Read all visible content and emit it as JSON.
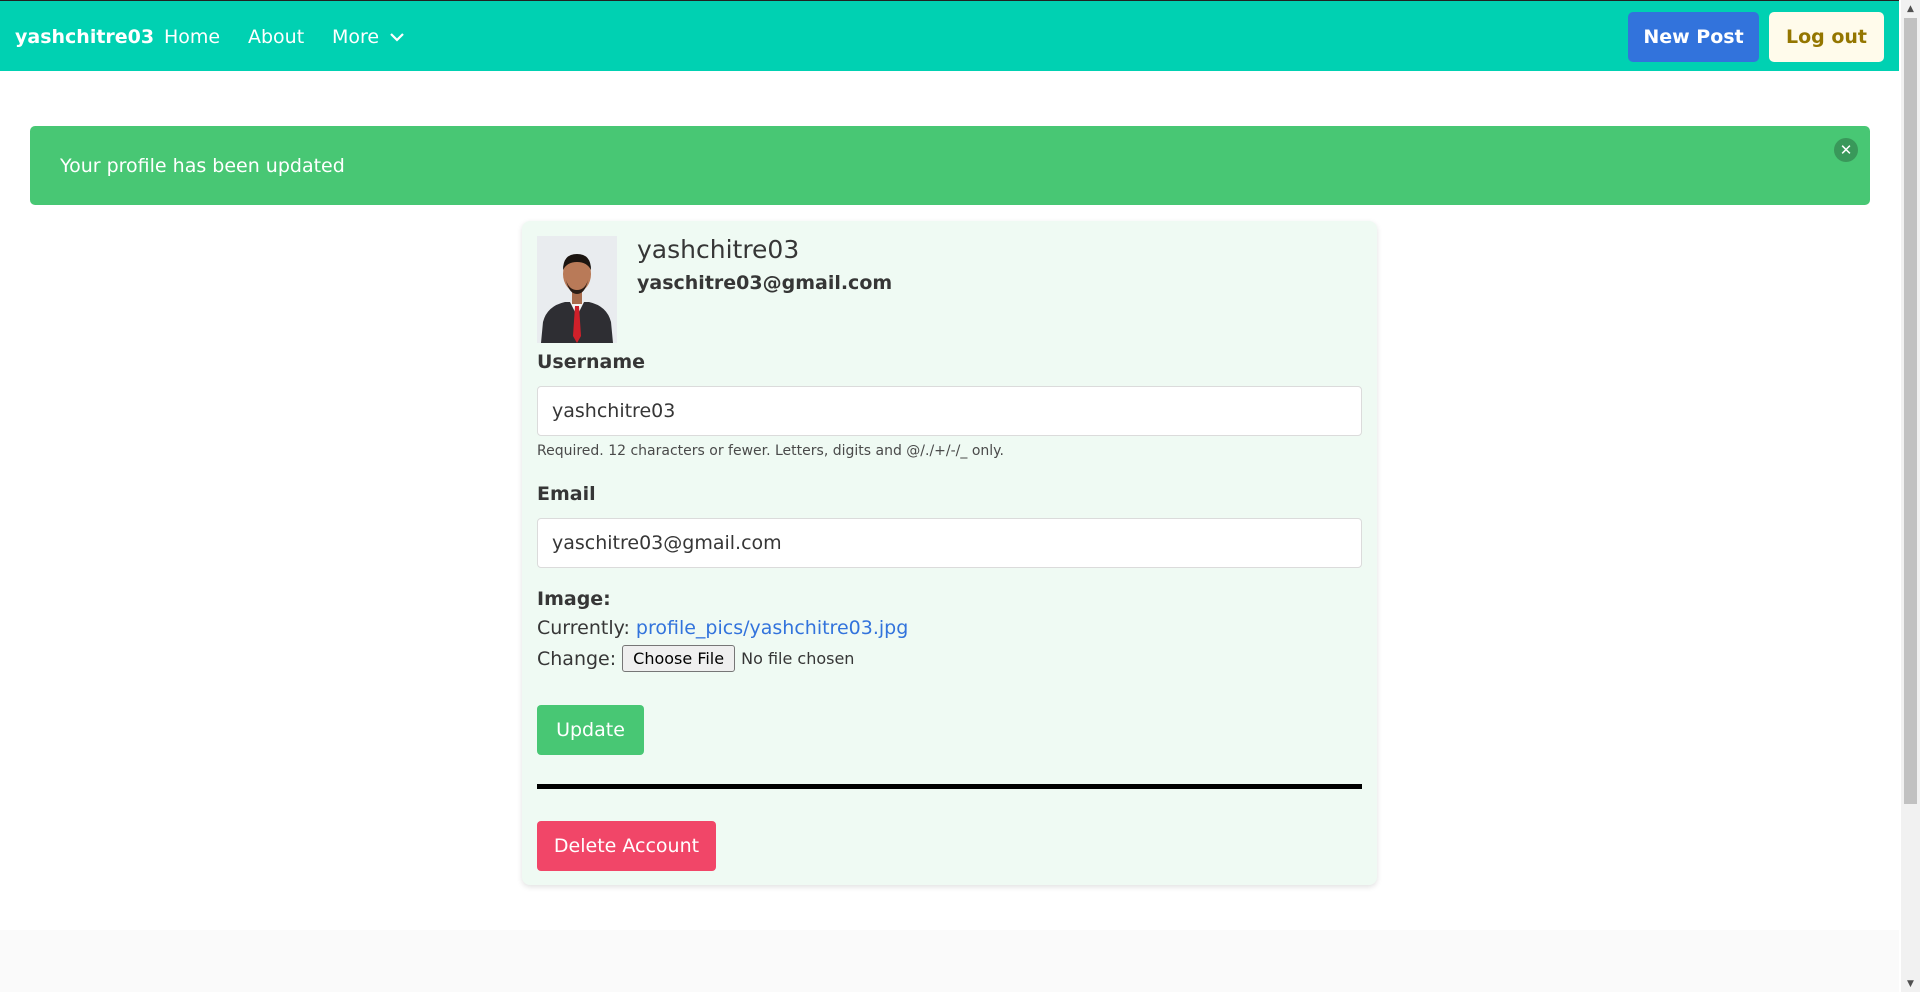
{
  "navbar": {
    "brand": "yashchitre03",
    "home": "Home",
    "about": "About",
    "more": "More",
    "new_post": "New Post",
    "logout": "Log out"
  },
  "notification": {
    "message": "Your profile has been updated",
    "close_icon": "close-icon"
  },
  "profile": {
    "username": "yashchitre03",
    "email": "yaschitre03@gmail.com"
  },
  "form": {
    "username_label": "Username",
    "username_value": "yashchitre03",
    "username_help": "Required. 12 characters or fewer. Letters, digits and @/./+/-/_ only.",
    "email_label": "Email",
    "email_value": "yaschitre03@gmail.com",
    "image_label": "Image:",
    "currently_label": "Currently:",
    "current_image": "profile_pics/yashchitre03.jpg",
    "change_label": "Change:",
    "choose_file": "Choose File",
    "no_file": "No file chosen",
    "update_button": "Update",
    "delete_button": "Delete Account"
  },
  "colors": {
    "navbar": "#00d1b2",
    "primary": "#3273dc",
    "success": "#48c774",
    "danger": "#f14668",
    "warning_light": "#fffbeb",
    "card_bg": "#effaf3"
  }
}
